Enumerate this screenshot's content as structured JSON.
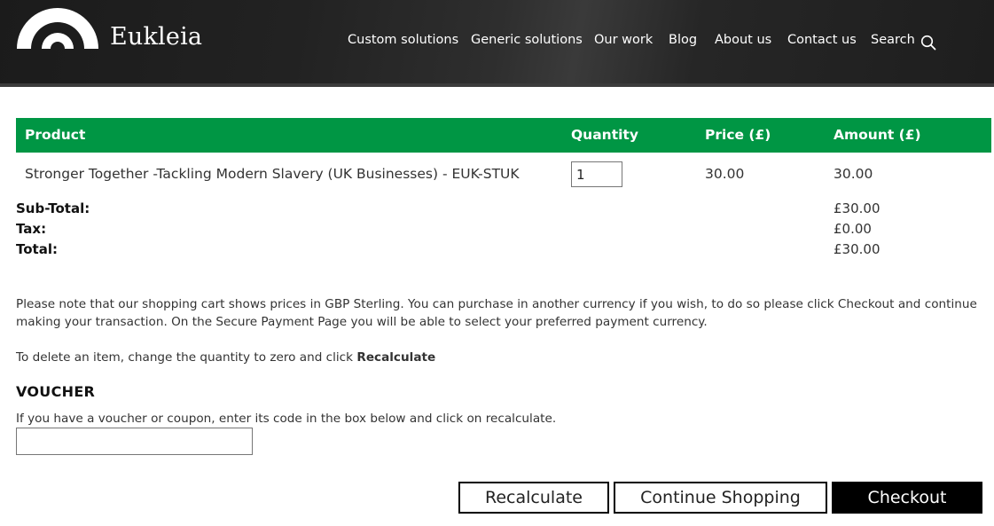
{
  "header": {
    "brand": "Eukleia",
    "nav": [
      {
        "label": "Custom solutions"
      },
      {
        "label": "Generic solutions"
      },
      {
        "label": "Our work"
      },
      {
        "label": "Blog"
      },
      {
        "label": "About us"
      },
      {
        "label": "Contact us"
      },
      {
        "label": "Search"
      }
    ]
  },
  "cart": {
    "columns": [
      "Product",
      "Quantity",
      "Price (£)",
      "Amount (£)"
    ],
    "rows": [
      {
        "product": "Stronger Together -Tackling Modern Slavery (UK Businesses) - EUK-STUK",
        "quantity": "1",
        "price": "30.00",
        "amount": "30.00"
      }
    ],
    "totals": {
      "subtotal_label": "Sub-Total:",
      "subtotal": "£30.00",
      "tax_label": "Tax:",
      "tax": "£0.00",
      "total_label": "Total:",
      "total": "£30.00"
    }
  },
  "notes": {
    "currency": "Please note that our shopping cart shows prices in GBP Sterling. You can purchase in another currency if you wish, to do so please click Checkout and continue making your transaction. On the Secure Payment Page you will be able to select your preferred payment currency.",
    "delete_prefix": "To delete an item, change the quantity to zero and click ",
    "delete_bold": "Recalculate"
  },
  "voucher": {
    "title": "VOUCHER",
    "instructions": "If you have a voucher or coupon, enter its code in the box below and click on recalculate.",
    "value": ""
  },
  "buttons": {
    "recalculate": "Recalculate",
    "continue": "Continue Shopping",
    "checkout": "Checkout"
  },
  "colors": {
    "header_bg": "#1e1e1e",
    "table_header": "#009644",
    "checkout_bg": "#000000"
  }
}
